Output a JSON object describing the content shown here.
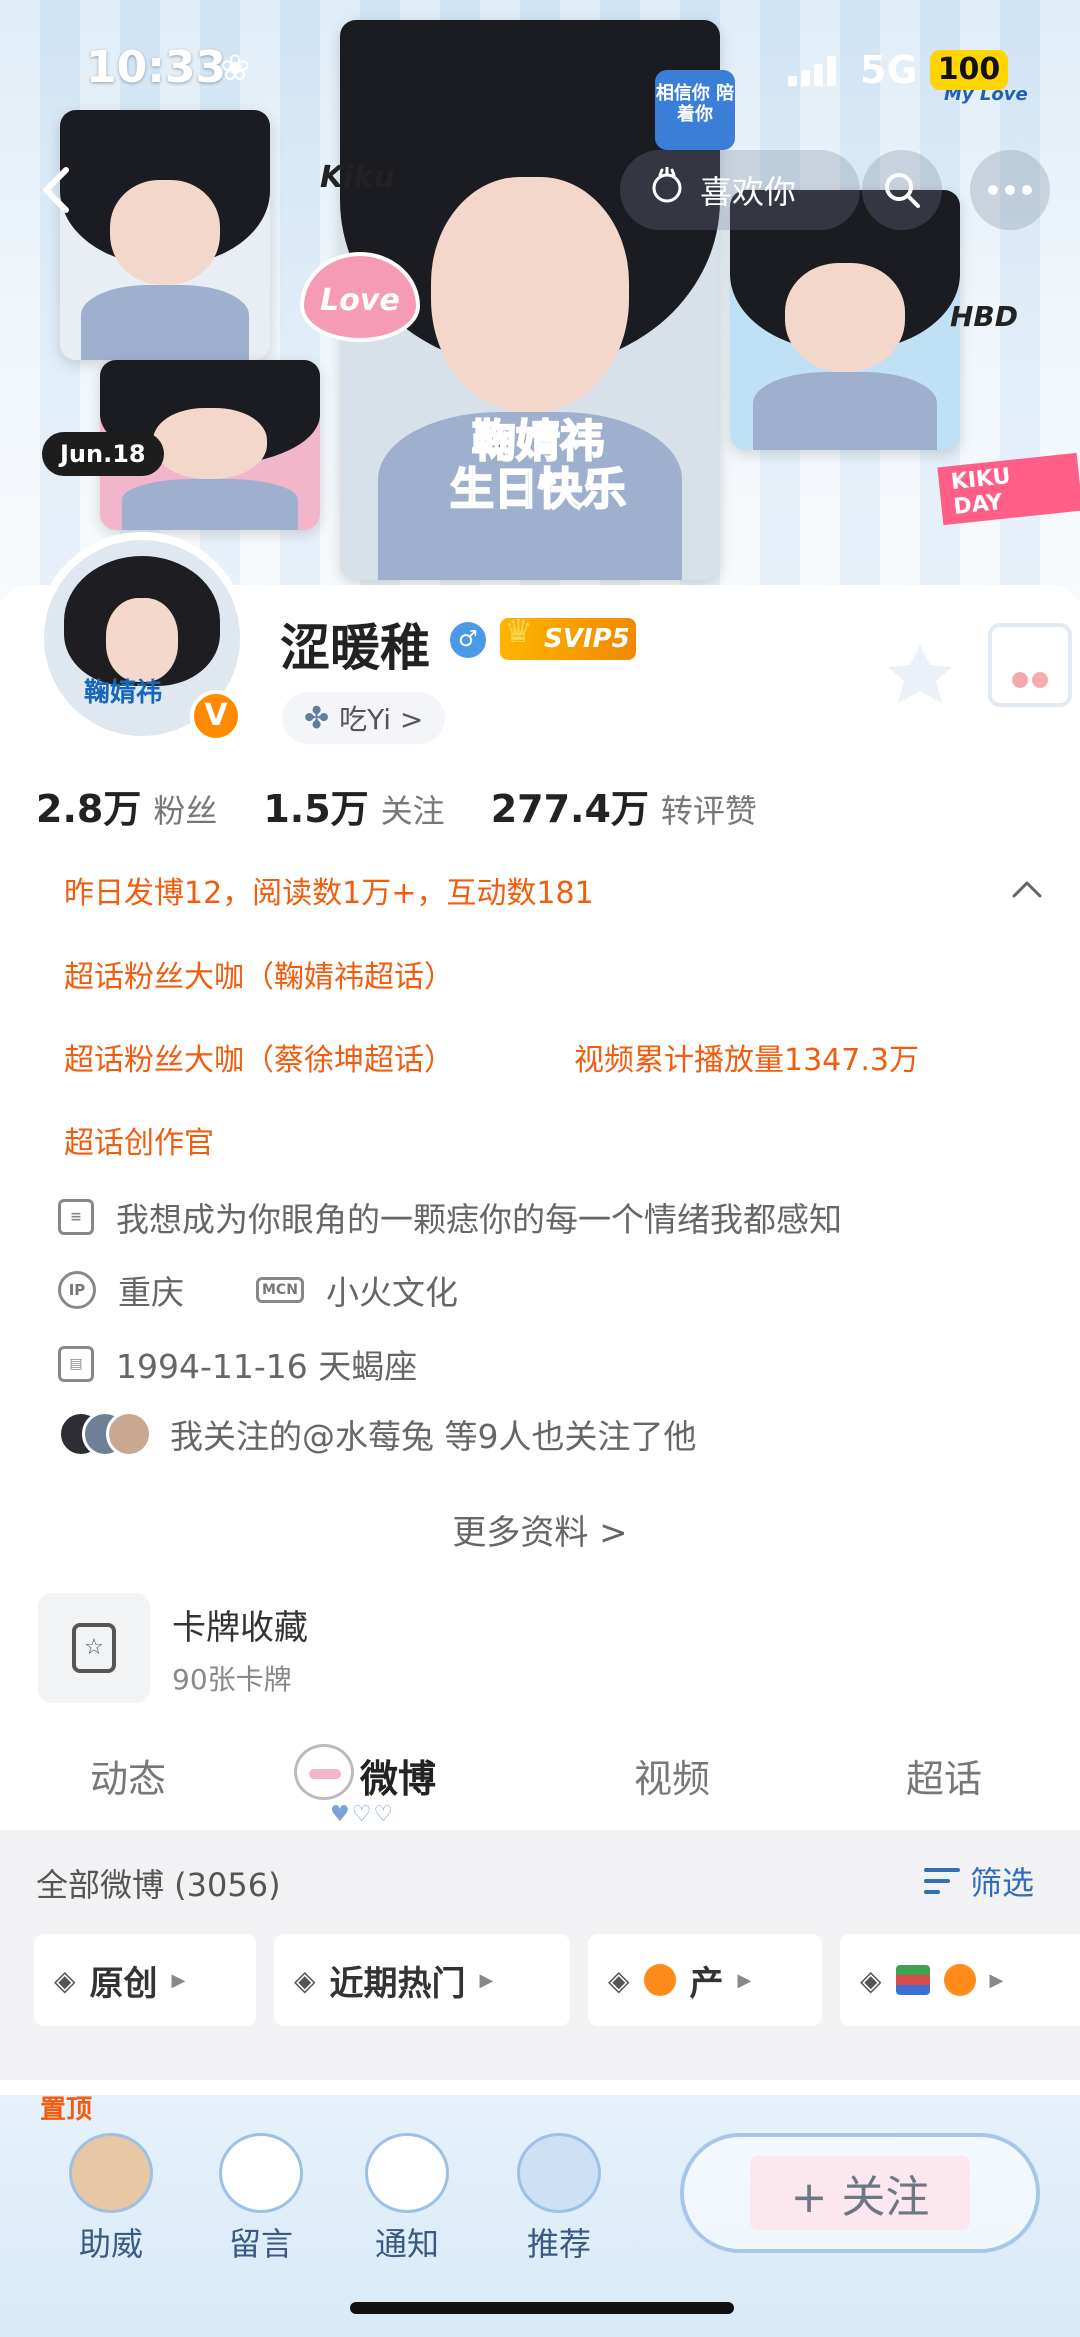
{
  "status_bar": {
    "time": "10:33",
    "network": "5G",
    "battery": "100"
  },
  "banner": {
    "stickers": {
      "kiku": "Kiku",
      "love": "Love",
      "jun": "Jun.18",
      "birthday_line1": "鞠婧祎",
      "birthday_line2": "生日快乐",
      "hbd": "HBD",
      "kikuday": "KIKU DAY",
      "mylove": "My Love",
      "bubble": "相信你 陪着你"
    }
  },
  "header": {
    "like_label": "喜欢你",
    "icons": [
      "back-icon",
      "like-hand-icon",
      "search-icon",
      "more-icon"
    ]
  },
  "profile": {
    "name": "涩暖稚",
    "svip_label": "SVIP5",
    "verified_mark": "V",
    "gender_mark": "♂",
    "tag_label": "吃Yi >",
    "stats": [
      {
        "num": "2.8万",
        "label": "粉丝"
      },
      {
        "num": "1.5万",
        "label": "关注"
      },
      {
        "num": "277.4万",
        "label": "转评赞"
      }
    ],
    "achievements": {
      "yesterday": "昨日发博12，阅读数1万+，互动数181",
      "topic1": "超话粉丝大咖（鞠婧祎超话）",
      "topic2": "超话粉丝大咖（蔡徐坤超话）",
      "video": "视频累计播放量1347.3万",
      "creator": "超话创作官"
    },
    "bio": "我想成为你眼角的一颗痣你的每一个情绪我都感知",
    "ip_label": "IP",
    "ip_location": "重庆",
    "mcn_label": "MCN",
    "mcn": "小火文化",
    "birthday": "1994-11-16 天蝎座",
    "mutual_follow": "我关注的@水莓兔  等9人也关注了他",
    "more_info": "更多资料 >"
  },
  "card_collection": {
    "title": "卡牌收藏",
    "subtitle": "90张卡牌"
  },
  "tabs": [
    "动态",
    "微博",
    "视频",
    "超话"
  ],
  "active_tab": "微博",
  "feed_filter": {
    "all_label": "全部微博 (3056)",
    "filter_label": "筛选",
    "chips": [
      "原创",
      "近期热门",
      "产",
      ""
    ]
  },
  "bottom_bar": {
    "peek_text": "置顶",
    "items": [
      "助威",
      "留言",
      "通知",
      "推荐"
    ],
    "follow_label": "+ 关注"
  },
  "colors": {
    "accent_orange": "#f25c0e",
    "link_blue": "#2f6fb8",
    "svip_gold": "#ffb400",
    "verified_orange": "#ff8a00"
  }
}
